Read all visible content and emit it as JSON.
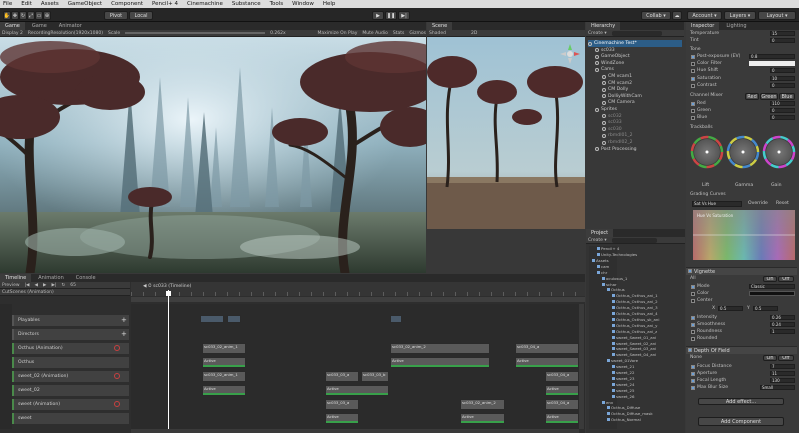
{
  "menu": [
    "File",
    "Edit",
    "Assets",
    "GameObject",
    "Component",
    "Pencil+ 4",
    "Cinemachine",
    "Substance",
    "Tools",
    "Window",
    "Help"
  ],
  "toolbar": {
    "pivot": "Pivot",
    "local": "Local",
    "collab": "Collab ▾",
    "account": "Account ▾",
    "layers": "Layers ▾",
    "layout": "Layout ▾"
  },
  "game_view": {
    "tabs": [
      "Game",
      "Game",
      "Animator"
    ],
    "display": "Display 2",
    "resolution": "RecordingResolution(1920x1080)",
    "scale_label": "Scale",
    "scale_value": "0.262x",
    "maximize": "Maximize On Play",
    "mute": "Mute Audio",
    "stats": "Stats",
    "gizmos": "Gizmos"
  },
  "scene_view": {
    "tab": "Scene",
    "shading": "Shaded",
    "mode": "2D"
  },
  "hierarchy": {
    "tab": "Hierarchy",
    "create": "Create ▾",
    "items": [
      {
        "label": "Cinemachine Test*",
        "sel": true
      },
      {
        "label": "sc033"
      },
      {
        "label": "GameObject"
      },
      {
        "label": "WindZone"
      },
      {
        "label": "Cams"
      },
      {
        "label": "CM vcam1"
      },
      {
        "label": "CM vcam2"
      },
      {
        "label": "CM Dolly"
      },
      {
        "label": "DolliyWithCam"
      },
      {
        "label": "CM Camera"
      },
      {
        "label": "Sprites"
      },
      {
        "label": "sc032",
        "dim": true
      },
      {
        "label": "sc033",
        "dim": true
      },
      {
        "label": "sc030",
        "dim": true
      },
      {
        "label": "rbmdl01_2",
        "dim": true
      },
      {
        "label": "rbmdl02_2",
        "dim": true
      },
      {
        "label": "Post Processing"
      }
    ]
  },
  "inspector": {
    "tabs": [
      "Inspector",
      "Lighting"
    ],
    "temperature_label": "Temperature",
    "temperature": "15",
    "tint_label": "Tint",
    "tint": "0",
    "tone_label": "Tone",
    "post_exposure_label": "Post-exposure (EV)",
    "post_exposure": "0.8",
    "color_filter_label": "Color Filter",
    "hue_shift_label": "Hue Shift",
    "hue_shift": "0",
    "saturation_label": "Saturation",
    "saturation": "10",
    "contrast_label": "Contrast",
    "contrast": "0",
    "channel_mixer_label": "Channel Mixer",
    "channel_buttons": [
      "Red",
      "Green",
      "Blue"
    ],
    "red_label": "Red",
    "red": "110",
    "green_label": "Green",
    "green": "0",
    "blue_label": "Blue",
    "blue": "0",
    "trackballs_label": "Trackballs",
    "wheels": [
      "Lift",
      "Gamma",
      "Gain"
    ],
    "grading_curves_label": "Grading Curves",
    "curve_select": "Sat Vs Hue",
    "override": "Override",
    "reset": "Reset",
    "curve_hint": "Hue Vs Saturation",
    "vignette_label": "Vignette",
    "toggle_on": "On",
    "toggle_off": "Off",
    "all": "All",
    "none": "None",
    "mode_label": "Mode",
    "mode_value": "Classic",
    "color_label": "Color",
    "center_label": "Center",
    "center_x_label": "X",
    "center_x": "0.5",
    "center_y_label": "Y",
    "center_y": "0.5",
    "intensity_label": "Intensity",
    "intensity": "0.26",
    "smoothness_label": "Smoothness",
    "smoothness": "0.24",
    "roundness_label": "Roundness",
    "roundness": "1",
    "rounded_label": "Rounded",
    "dof_label": "Depth Of Field",
    "focus_distance_label": "Focus Distance",
    "focus_distance": "7",
    "aperture_label": "Aperture",
    "aperture": "11",
    "focal_length_label": "Focal Length",
    "focal_length": "130",
    "max_blur_label": "Max Blur Size",
    "max_blur": "Small",
    "add_effect": "Add effect...",
    "add_component": "Add Component"
  },
  "project": {
    "tab": "Project",
    "create": "Create ▾",
    "items": [
      {
        "label": "Pencil+ 4",
        "indent": 1
      },
      {
        "label": "Unity-Technologies",
        "indent": 1
      },
      {
        "label": "Assets",
        "indent": 0
      },
      {
        "label": "cam",
        "indent": 1
      },
      {
        "label": "chr",
        "indent": 1
      },
      {
        "label": "oculosus_1",
        "indent": 2
      },
      {
        "label": "schar",
        "indent": 2
      },
      {
        "label": "Octhus",
        "indent": 3
      },
      {
        "label": "Octhus_Octhus_ani_1",
        "indent": 4
      },
      {
        "label": "Octhus_Octhus_ani_2",
        "indent": 4
      },
      {
        "label": "Octhus_Octhus_ani_3",
        "indent": 4
      },
      {
        "label": "Octhus_Octhus_ani_4",
        "indent": 4
      },
      {
        "label": "Octhus_Octhus_sk_ani",
        "indent": 4
      },
      {
        "label": "Octhus_Octhus_ani_y",
        "indent": 4
      },
      {
        "label": "Octhus_Octhus_ani_z",
        "indent": 4
      },
      {
        "label": "sweet_Sweet_01_ani",
        "indent": 4
      },
      {
        "label": "sweet_Sweet_02_ani",
        "indent": 4
      },
      {
        "label": "sweet_Sweet_03_ani",
        "indent": 4
      },
      {
        "label": "sweet_Sweet_04_ani",
        "indent": 4
      },
      {
        "label": "sweet_01Vore",
        "indent": 3
      },
      {
        "label": "sweet_21",
        "indent": 4
      },
      {
        "label": "sweet_22",
        "indent": 4
      },
      {
        "label": "sweet_23",
        "indent": 4
      },
      {
        "label": "sweet_24",
        "indent": 4
      },
      {
        "label": "sweet_25",
        "indent": 4
      },
      {
        "label": "sweet_26",
        "indent": 4
      },
      {
        "label": "env",
        "indent": 2
      },
      {
        "label": "Octhus_Diffuse",
        "indent": 3
      },
      {
        "label": "Octhus_Diffuse_mask",
        "indent": 3
      },
      {
        "label": "Octhus_Normal",
        "indent": 3
      }
    ]
  },
  "timeline": {
    "tabs": [
      "Timeline",
      "Animation",
      "Console"
    ],
    "preview": "Preview",
    "frame": "65",
    "director": "CutScenes (Animation)",
    "clip_label": "sc033 (Timeline)",
    "tracks": [
      {
        "label": "Playables"
      },
      {
        "label": "Directors"
      },
      {
        "label": "Octhus (Animation)"
      },
      {
        "label": "Octhus"
      },
      {
        "label": "sweet_02 (Animation)"
      },
      {
        "label": "sweet_02"
      },
      {
        "label": "sweet (Animation)"
      },
      {
        "label": "sweet"
      }
    ],
    "clip_texts": {
      "a": "sc033_02_anim_1",
      "b": "Active",
      "c": "sc033_02_anim_2",
      "d": "sc033_03_a",
      "e": "sc033_04_a",
      "f": "sc033_03_b"
    }
  },
  "colors": {
    "accent": "#2c5d87",
    "track_green": "#38a04a",
    "record_red": "#c84040"
  }
}
